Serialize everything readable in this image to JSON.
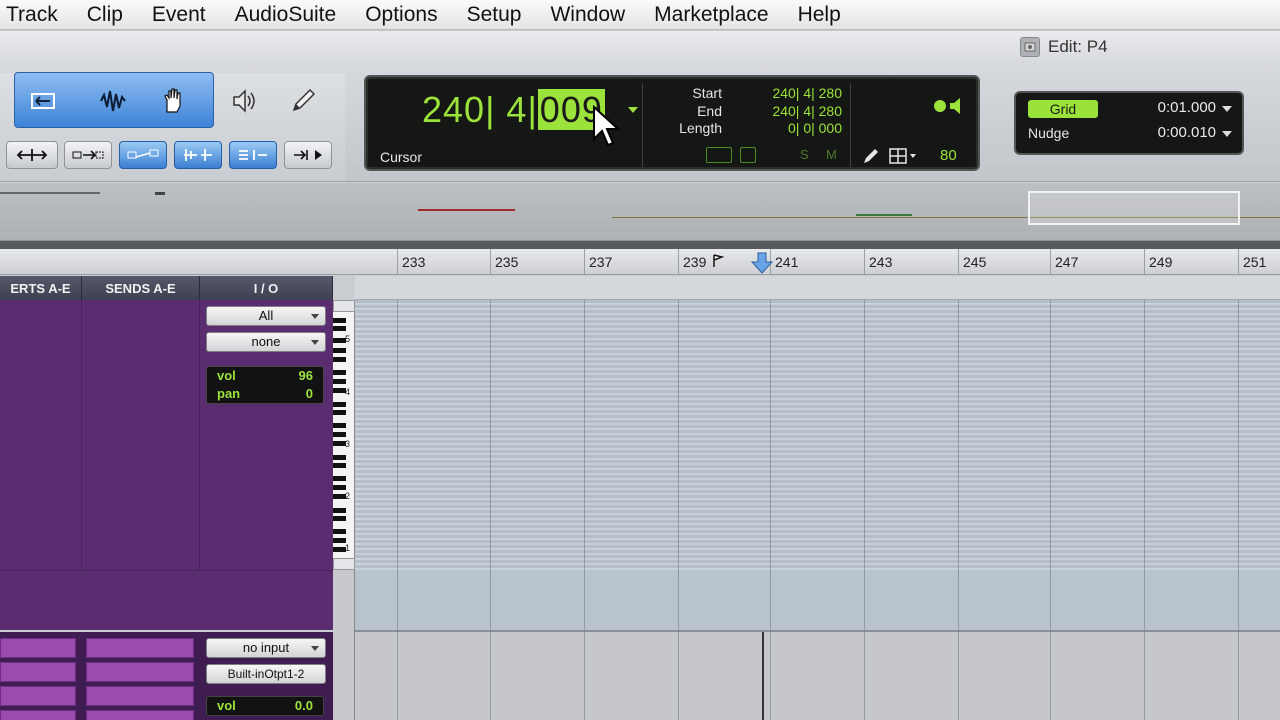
{
  "menu": [
    "Track",
    "Clip",
    "Event",
    "AudioSuite",
    "Options",
    "Setup",
    "Window",
    "Marketplace",
    "Help"
  ],
  "window": {
    "title": "Edit: P4"
  },
  "counter": {
    "main_prefix": "240| 4|",
    "main_highlight": "009",
    "cursor_label": "Cursor",
    "start_label": "Start",
    "end_label": "End",
    "length_label": "Length",
    "start_value": "240| 4| 280",
    "end_value": "240| 4| 280",
    "length_value": "0| 0| 000",
    "tempo": "80",
    "solo_label": "S",
    "mute_label": "M"
  },
  "grid_nudge": {
    "grid_label": "Grid",
    "grid_value": "0:01.000",
    "nudge_label": "Nudge",
    "nudge_value": "0:00.010"
  },
  "ruler": {
    "bars": [
      "233",
      "235",
      "237",
      "239",
      "241",
      "243",
      "245",
      "247",
      "249",
      "251"
    ]
  },
  "columns": {
    "inserts": "ERTS A-E",
    "sends": "SENDS A-E",
    "io": "I / O"
  },
  "midi_track": {
    "input": "All",
    "output": "none",
    "vol_label": "vol",
    "vol_value": "96",
    "pan_label": "pan",
    "pan_value": "0",
    "octaves": [
      "5",
      "4",
      "3",
      "2",
      "1"
    ]
  },
  "audio_track": {
    "input": "no input",
    "output": "Built-inOtpt1-2",
    "vol_label": "vol",
    "vol_value": "0.0"
  },
  "colors": {
    "counter_green": "#9be33a",
    "track_purple": "#5a2d71",
    "tool_blue": "#3d84d8"
  },
  "icons": [
    "zoom-icon",
    "trim-icon",
    "selector-icon",
    "grabber-icon",
    "scrub-icon",
    "pencil-icon"
  ]
}
